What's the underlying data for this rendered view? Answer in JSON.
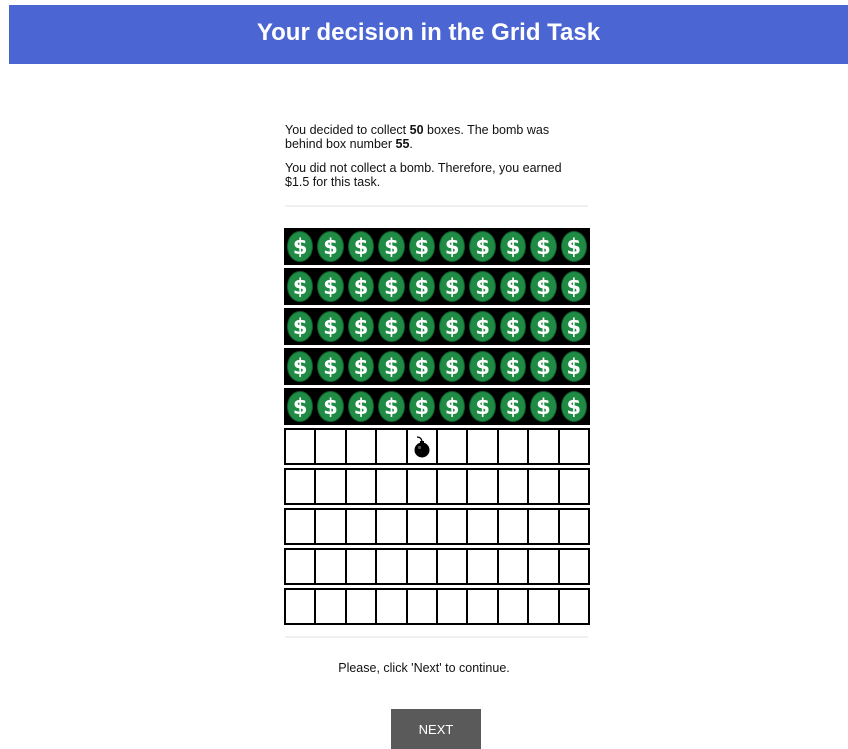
{
  "header": {
    "title": "Your decision in the Grid Task"
  },
  "summary": {
    "line1_part1": "You decided to collect ",
    "collected_boxes": "50",
    "line1_part2": " boxes. The bomb was behind box number ",
    "bomb_box": "55",
    "line1_part3": ".",
    "line2": "You did not collect a bomb. Therefore, you earned $1.5 for this task."
  },
  "grid": {
    "rows": 10,
    "columns": 10,
    "collected_count": 50,
    "bomb_box_number": 55,
    "collected_icon": "dollar-coin-icon",
    "bomb_icon": "bomb-icon",
    "coin_color": "#1f8b45",
    "coin_glyph": "$"
  },
  "footer": {
    "instruction": "Please, click 'Next' to continue.",
    "next_label": "NEXT"
  },
  "colors": {
    "header_bg": "#4b66d2",
    "button_bg": "#5a5a5a"
  }
}
